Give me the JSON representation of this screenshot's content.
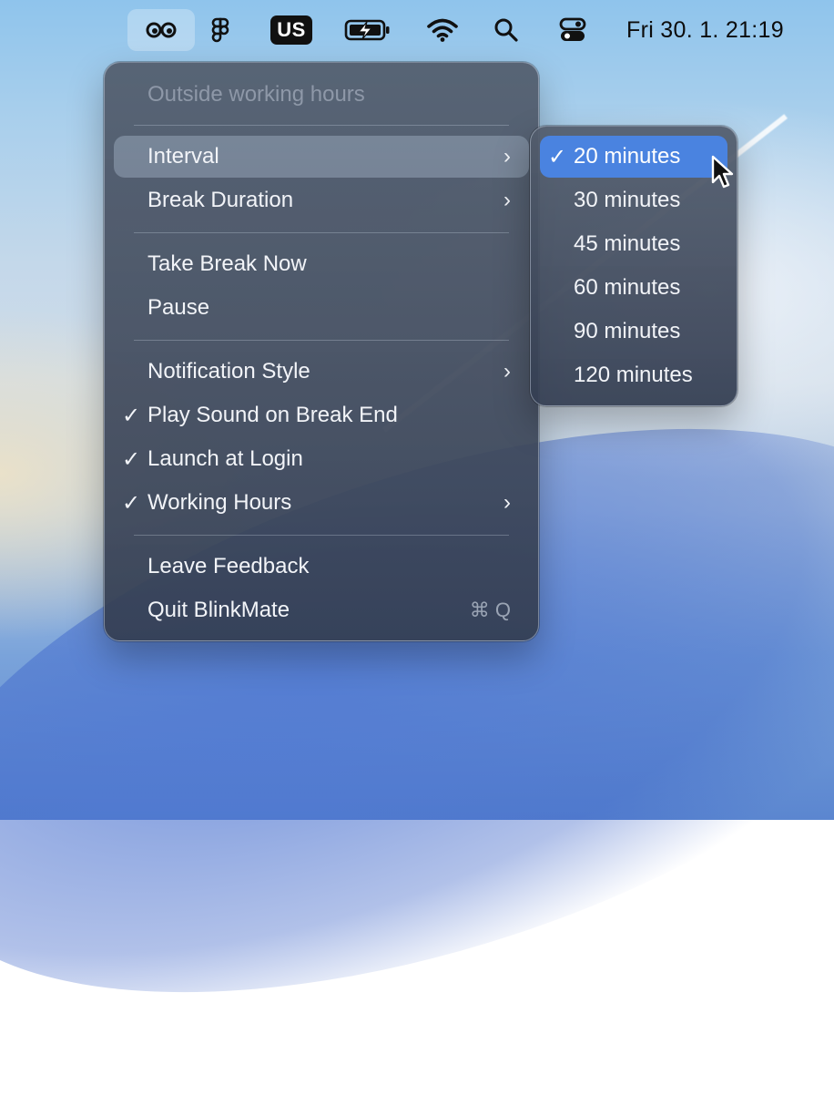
{
  "menubar": {
    "icons": [
      "blinkmate-eyes-icon",
      "figma-icon",
      "keyboard-layout-icon",
      "battery-charging-icon",
      "wifi-icon",
      "spotlight-search-icon",
      "control-center-icon"
    ],
    "keyboard_layout": "US",
    "clock": "Fri 30. 1.  21:19"
  },
  "menu": {
    "status": "Outside working hours",
    "items": {
      "interval": "Interval",
      "break_duration": "Break Duration",
      "take_break_now": "Take Break Now",
      "pause": "Pause",
      "notification_style": "Notification Style",
      "play_sound": "Play Sound on Break End",
      "launch_at_login": "Launch at Login",
      "working_hours": "Working Hours",
      "leave_feedback": "Leave Feedback",
      "quit": "Quit BlinkMate",
      "quit_shortcut": "⌘ Q"
    },
    "check_glyph": "✓",
    "chevron_glyph": "›"
  },
  "interval_submenu": {
    "selected": "20 minutes",
    "options": [
      "20 minutes",
      "30 minutes",
      "45 minutes",
      "60 minutes",
      "90 minutes",
      "120 minutes"
    ]
  },
  "colors": {
    "selection": "#4a83e0",
    "menu_background": "#3c4658"
  }
}
